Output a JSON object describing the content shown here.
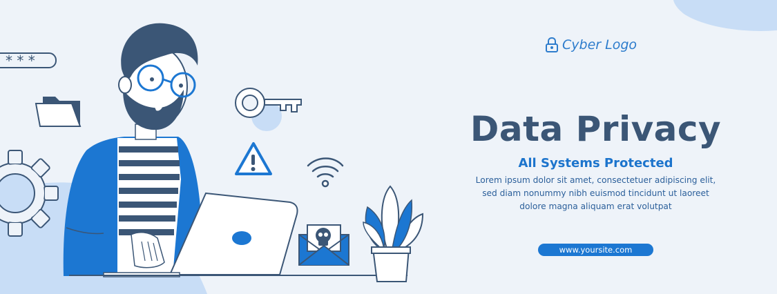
{
  "brand": {
    "logo_text": "Cyber Logo",
    "logo_icon": "padlock-icon"
  },
  "hero": {
    "title": "Data Privacy",
    "subtitle": "All Systems Protected",
    "body_lines": [
      "Lorem ipsum dolor sit amet, consectetuer adipiscing elit,",
      "sed diam nonummy nibh euismod tincidunt ut laoreet",
      "dolore magna aliquam erat volutpat"
    ]
  },
  "cta": {
    "website_label": "www.yoursite.com"
  },
  "illustration": {
    "password_mask": "* * *"
  },
  "colors": {
    "background": "#eef3f9",
    "primary_blue": "#1c77d2",
    "navy": "#3b5676",
    "light_blue": "#c9ddf5"
  }
}
